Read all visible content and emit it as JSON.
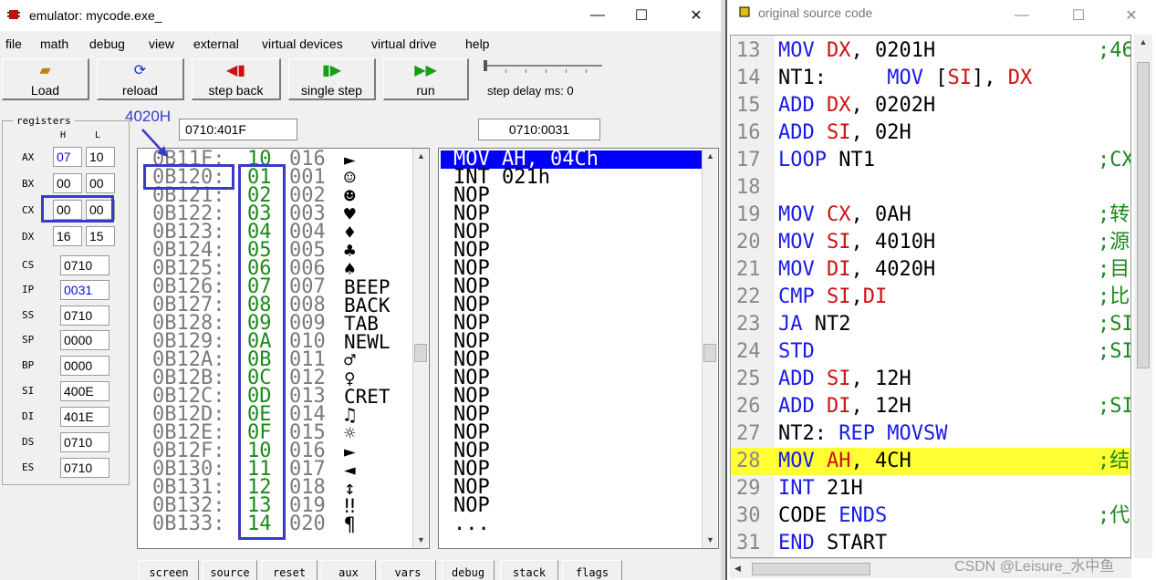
{
  "emulator": {
    "title": "emulator: mycode.exe_",
    "window_controls": {
      "minimize": "—",
      "maximize": "☐",
      "close": "✕"
    },
    "menu": [
      "file",
      "math",
      "debug",
      "view",
      "external",
      "virtual devices",
      "virtual drive",
      "help"
    ],
    "toolbar": [
      {
        "label": "Load",
        "icon": "folder-open-icon",
        "glyph": "📂",
        "color": "#c08000"
      },
      {
        "label": "reload",
        "icon": "reload-icon",
        "glyph": "⟳",
        "color": "#1030d0"
      },
      {
        "label": "step back",
        "icon": "step-back-icon",
        "glyph": "◀|",
        "color": "#d01010"
      },
      {
        "label": "single step",
        "icon": "single-step-icon",
        "glyph": "|▶",
        "color": "#10a010"
      },
      {
        "label": "run",
        "icon": "run-icon",
        "glyph": "▶▶",
        "color": "#10a010"
      }
    ],
    "step_delay_label": "step delay ms: 0",
    "step_delay_ms": 0,
    "registers_title": "registers",
    "reg_headers": {
      "h": "H",
      "l": "L"
    },
    "registers_split": [
      {
        "name": "AX",
        "h": "07",
        "l": "10"
      },
      {
        "name": "BX",
        "h": "00",
        "l": "00"
      },
      {
        "name": "CX",
        "h": "00",
        "l": "00"
      },
      {
        "name": "DX",
        "h": "16",
        "l": "15"
      }
    ],
    "registers_full": [
      {
        "name": "CS",
        "value": "0710"
      },
      {
        "name": "IP",
        "value": "0031"
      },
      {
        "name": "SS",
        "value": "0710"
      },
      {
        "name": "SP",
        "value": "0000"
      },
      {
        "name": "BP",
        "value": "0000"
      },
      {
        "name": "SI",
        "value": "400E"
      },
      {
        "name": "DI",
        "value": "401E"
      },
      {
        "name": "DS",
        "value": "0710"
      },
      {
        "name": "ES",
        "value": "0710"
      }
    ],
    "memory_address": "0710:401F",
    "disasm_address": "0710:0031",
    "memory_rows": [
      {
        "addr": "0B11F:",
        "hex": "10",
        "dec": "016",
        "chr": "►"
      },
      {
        "addr": "0B120:",
        "hex": "01",
        "dec": "001",
        "chr": "☺"
      },
      {
        "addr": "0B121:",
        "hex": "02",
        "dec": "002",
        "chr": "☻"
      },
      {
        "addr": "0B122:",
        "hex": "03",
        "dec": "003",
        "chr": "♥"
      },
      {
        "addr": "0B123:",
        "hex": "04",
        "dec": "004",
        "chr": "♦"
      },
      {
        "addr": "0B124:",
        "hex": "05",
        "dec": "005",
        "chr": "♣"
      },
      {
        "addr": "0B125:",
        "hex": "06",
        "dec": "006",
        "chr": "♠"
      },
      {
        "addr": "0B126:",
        "hex": "07",
        "dec": "007",
        "chr": "BEEP"
      },
      {
        "addr": "0B127:",
        "hex": "08",
        "dec": "008",
        "chr": "BACK"
      },
      {
        "addr": "0B128:",
        "hex": "09",
        "dec": "009",
        "chr": "TAB"
      },
      {
        "addr": "0B129:",
        "hex": "0A",
        "dec": "010",
        "chr": "NEWL"
      },
      {
        "addr": "0B12A:",
        "hex": "0B",
        "dec": "011",
        "chr": "♂"
      },
      {
        "addr": "0B12B:",
        "hex": "0C",
        "dec": "012",
        "chr": "♀"
      },
      {
        "addr": "0B12C:",
        "hex": "0D",
        "dec": "013",
        "chr": "CRET"
      },
      {
        "addr": "0B12D:",
        "hex": "0E",
        "dec": "014",
        "chr": "♫"
      },
      {
        "addr": "0B12E:",
        "hex": "0F",
        "dec": "015",
        "chr": "☼"
      },
      {
        "addr": "0B12F:",
        "hex": "10",
        "dec": "016",
        "chr": "►"
      },
      {
        "addr": "0B130:",
        "hex": "11",
        "dec": "017",
        "chr": "◄"
      },
      {
        "addr": "0B131:",
        "hex": "12",
        "dec": "018",
        "chr": "↕"
      },
      {
        "addr": "0B132:",
        "hex": "13",
        "dec": "019",
        "chr": "‼"
      },
      {
        "addr": "0B133:",
        "hex": "14",
        "dec": "020",
        "chr": "¶"
      }
    ],
    "disasm_rows": [
      "MOV AH, 04Ch",
      "INT 021h",
      "NOP",
      "NOP",
      "NOP",
      "NOP",
      "NOP",
      "NOP",
      "NOP",
      "NOP",
      "NOP",
      "NOP",
      "NOP",
      "NOP",
      "NOP",
      "NOP",
      "NOP",
      "NOP",
      "NOP",
      "NOP",
      "..."
    ],
    "annotation_label": "4020H",
    "bottom_buttons": [
      "screen",
      "source",
      "reset",
      "aux",
      "vars",
      "debug",
      "stack",
      "flags"
    ],
    "colors": {
      "highlight": "#0000ff",
      "annotation": "#3a3ac8",
      "hex": "#1a8a1a"
    }
  },
  "source": {
    "title": "original source code",
    "window_controls": {
      "minimize": "—",
      "maximize": "☐",
      "close": "✕"
    },
    "lines": [
      {
        "n": "13",
        "parts": [
          [
            "kw",
            "MOV "
          ],
          [
            "reg",
            "DX"
          ],
          [
            "plain",
            ", 0201H"
          ]
        ],
        "comment": ";46"
      },
      {
        "n": "14",
        "parts": [
          [
            "plain",
            "NT1:     "
          ],
          [
            "kw",
            "MOV "
          ],
          [
            "plain",
            "["
          ],
          [
            "reg",
            "SI"
          ],
          [
            "plain",
            "], "
          ],
          [
            "reg",
            "DX"
          ]
        ],
        "comment": ""
      },
      {
        "n": "15",
        "parts": [
          [
            "kw",
            "ADD "
          ],
          [
            "reg",
            "DX"
          ],
          [
            "plain",
            ", 0202H"
          ]
        ],
        "comment": ""
      },
      {
        "n": "16",
        "parts": [
          [
            "kw",
            "ADD "
          ],
          [
            "reg",
            "SI"
          ],
          [
            "plain",
            ", 02H"
          ]
        ],
        "comment": ""
      },
      {
        "n": "17",
        "parts": [
          [
            "kw",
            "LOOP "
          ],
          [
            "plain",
            "NT1"
          ]
        ],
        "comment": ";CX"
      },
      {
        "n": "18",
        "parts": [],
        "comment": ""
      },
      {
        "n": "19",
        "parts": [
          [
            "kw",
            "MOV "
          ],
          [
            "reg",
            "CX"
          ],
          [
            "plain",
            ", 0AH"
          ]
        ],
        "comment": ";转"
      },
      {
        "n": "20",
        "parts": [
          [
            "kw",
            "MOV "
          ],
          [
            "reg",
            "SI"
          ],
          [
            "plain",
            ", 4010H"
          ]
        ],
        "comment": ";源"
      },
      {
        "n": "21",
        "parts": [
          [
            "kw",
            "MOV "
          ],
          [
            "reg",
            "DI"
          ],
          [
            "plain",
            ", 4020H"
          ]
        ],
        "comment": ";目"
      },
      {
        "n": "22",
        "parts": [
          [
            "kw",
            "CMP "
          ],
          [
            "reg",
            "SI"
          ],
          [
            "plain",
            ","
          ],
          [
            "reg",
            "DI"
          ]
        ],
        "comment": ";比"
      },
      {
        "n": "23",
        "parts": [
          [
            "kw",
            "JA "
          ],
          [
            "plain",
            "NT2"
          ]
        ],
        "comment": ";SI"
      },
      {
        "n": "24",
        "parts": [
          [
            "kw",
            "STD"
          ]
        ],
        "comment": ";SI"
      },
      {
        "n": "25",
        "parts": [
          [
            "kw",
            "ADD "
          ],
          [
            "reg",
            "SI"
          ],
          [
            "plain",
            ", 12H"
          ]
        ],
        "comment": ""
      },
      {
        "n": "26",
        "parts": [
          [
            "kw",
            "ADD "
          ],
          [
            "reg",
            "DI"
          ],
          [
            "plain",
            ", 12H"
          ]
        ],
        "comment": ";SI"
      },
      {
        "n": "27",
        "parts": [
          [
            "plain",
            "NT2: "
          ],
          [
            "kw",
            "REP MOVSW"
          ]
        ],
        "comment": ""
      },
      {
        "n": "28",
        "parts": [
          [
            "kw",
            "MOV "
          ],
          [
            "reg",
            "AH"
          ],
          [
            "plain",
            ", 4CH"
          ]
        ],
        "comment": ";结",
        "highlight": true
      },
      {
        "n": "29",
        "parts": [
          [
            "kw",
            "INT "
          ],
          [
            "plain",
            "21H"
          ]
        ],
        "comment": ""
      },
      {
        "n": "30",
        "parts": [
          [
            "plain",
            "CODE "
          ],
          [
            "kw",
            "ENDS"
          ]
        ],
        "comment": ";代"
      },
      {
        "n": "31",
        "parts": [
          [
            "kw",
            "END "
          ],
          [
            "plain",
            "START"
          ]
        ],
        "comment": ""
      }
    ],
    "colors": {
      "keyword": "#1a1ae6",
      "register": "#d01010",
      "comment": "#1a8a1a",
      "current_line": "#ffff33"
    }
  },
  "watermark": "CSDN @Leisure_水中鱼"
}
